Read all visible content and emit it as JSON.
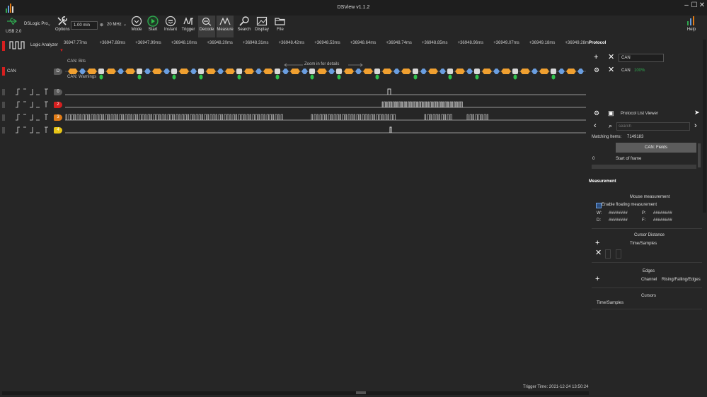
{
  "window": {
    "title": "DSView v1.1.2"
  },
  "device": {
    "name": "DSLogic Pro",
    "connection": "USB 2.0",
    "mode_label": "Logic Analyzer"
  },
  "toolbar": {
    "options_label": "Options",
    "duration": "1.00 min",
    "samplerate": "20 MHz",
    "mode_label": "Mode",
    "start_label": "Start",
    "instant_label": "Instant",
    "trigger_label": "Trigger",
    "decode_label": "Decode",
    "measure_label": "Measure",
    "search_label": "Search",
    "display_label": "Display",
    "file_label": "File",
    "help_label": "Help"
  },
  "ruler": {
    "ticks": [
      "36947.77ms",
      "+36947.88ms",
      "+36947.99ms",
      "+36948.10ms",
      "+36948.20ms",
      "+36948.31ms",
      "+36948.42ms",
      "+36948.53ms",
      "+36948.64ms",
      "+36948.74ms",
      "+36948.85ms",
      "+36948.96ms",
      "+36949.07ms",
      "+36949.18ms",
      "+36949.28ms"
    ]
  },
  "decoder_row": {
    "name": "CAN",
    "badge": "D",
    "bits_label": "CAN: Bits",
    "warnings_label": "CAN: Warnings",
    "zoom_hint": "Zoom in for details"
  },
  "channels": [
    {
      "index": "0",
      "color": "#5a5a5a"
    },
    {
      "index": "2",
      "color": "#d61f1f"
    },
    {
      "index": "3",
      "color": "#e07b16"
    },
    {
      "index": "4",
      "color": "#e8c516"
    }
  ],
  "protocol": {
    "header": "Protocol",
    "decoder_name": "CAN",
    "decoder_status_name": "CAN",
    "decoder_status": "100%",
    "list_viewer_title": "Protocol List Viewer",
    "search_placeholder": "search",
    "matching_label": "Matching Items:",
    "matching_count": "7149183",
    "column_header": "CAN: Fields",
    "rows": [
      {
        "index": "0",
        "value": "Start of frame"
      }
    ]
  },
  "measurement": {
    "header": "Measurement",
    "mouse_title": "Mouse measurement",
    "enable_floating": "Enable floating measurement",
    "w_label": "W:",
    "w_value": "########",
    "p_label": "P:",
    "p_value": "########",
    "d_label": "D:",
    "d_value": "########",
    "f_label": "F:",
    "f_value": "########",
    "cursor_distance_title": "Cursor Distance",
    "time_samples_label": "Time/Samples",
    "edges_title": "Edges",
    "channel_label": "Channel",
    "rising_falling_label": "Rising/Falling/Edges",
    "cursors_title": "Cursors",
    "cursors_time_samples": "Time/Samples"
  },
  "status": {
    "trigger_time": "Trigger Time: 2021-12-24 13:50:24"
  },
  "colors": {
    "accent": "#2fa84f",
    "orange": "#f0a030",
    "blue": "#6a9ee0",
    "green": "#2fc14b"
  }
}
